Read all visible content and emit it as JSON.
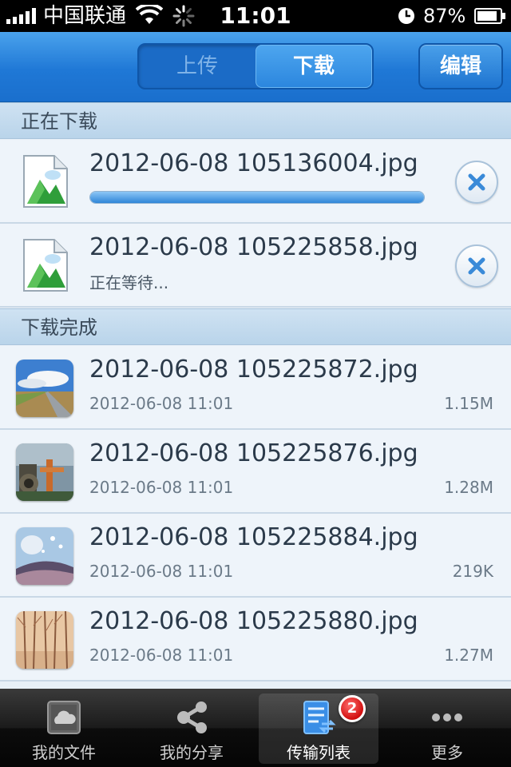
{
  "status_bar": {
    "carrier": "中国联通",
    "time": "11:01",
    "battery": "87%"
  },
  "nav": {
    "segments": [
      "上传",
      "下载"
    ],
    "selected_segment": "下载",
    "edit_label": "编辑"
  },
  "downloading": {
    "header": "正在下载",
    "items": [
      {
        "name": "2012-06-08 105136004.jpg",
        "progress": 1.0,
        "icon": "image-file-icon"
      },
      {
        "name": "2012-06-08 105225858.jpg",
        "status": "正在等待...",
        "icon": "image-file-icon"
      }
    ]
  },
  "completed": {
    "header": "下载完成",
    "items": [
      {
        "name": "2012-06-08 105225872.jpg",
        "date": "2012-06-08 11:01",
        "size": "1.15M",
        "thumb": "road-sky-photo"
      },
      {
        "name": "2012-06-08 105225876.jpg",
        "date": "2012-06-08 11:01",
        "size": "1.28M",
        "thumb": "industrial-photo"
      },
      {
        "name": "2012-06-08 105225884.jpg",
        "date": "2012-06-08 11:01",
        "size": "219K",
        "thumb": "dandelion-photo"
      },
      {
        "name": "2012-06-08 105225880.jpg",
        "date": "2012-06-08 11:01",
        "size": "1.27M",
        "thumb": "forest-photo"
      }
    ]
  },
  "tabbar": {
    "tabs": [
      {
        "label": "我的文件",
        "icon": "cloud-folder-icon"
      },
      {
        "label": "我的分享",
        "icon": "share-icon"
      },
      {
        "label": "传输列表",
        "icon": "transfer-list-icon",
        "badge": "2"
      },
      {
        "label": "更多",
        "icon": "more-icon"
      }
    ],
    "active_index": 2
  },
  "colors": {
    "nav_blue": "#1f78d6",
    "section_header": "#c3dbef",
    "row_bg": "#eef4fa",
    "badge_red": "#d10f0f"
  }
}
